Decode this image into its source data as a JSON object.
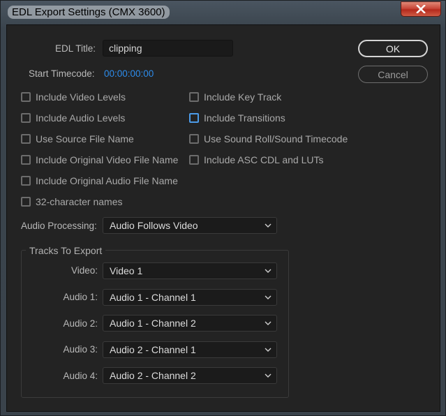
{
  "window": {
    "title": "EDL Export Settings (CMX 3600)",
    "close_icon": "close-icon"
  },
  "form": {
    "edl_title_label": "EDL Title:",
    "edl_title_value": "clipping",
    "start_timecode_label": "Start Timecode:",
    "start_timecode_value": "00:00:00:00"
  },
  "buttons": {
    "ok": "OK",
    "cancel": "Cancel"
  },
  "checkboxes": [
    {
      "label": "Include Video Levels",
      "checked": false
    },
    {
      "label": "Include Audio Levels",
      "checked": false
    },
    {
      "label": "Use Source File Name",
      "checked": false
    },
    {
      "label": "Include Original Video File Name",
      "checked": false
    },
    {
      "label": "Include Original Audio File Name",
      "checked": false
    },
    {
      "label": "32-character names",
      "checked": false
    },
    {
      "label": "Include Key Track",
      "checked": false
    },
    {
      "label": "Include Transitions",
      "checked": false,
      "focused": true
    },
    {
      "label": "Use Sound Roll/Sound Timecode",
      "checked": false
    },
    {
      "label": "Include ASC CDL and LUTs",
      "checked": false
    }
  ],
  "audio_processing": {
    "label": "Audio Processing:",
    "value": "Audio Follows Video"
  },
  "tracks": {
    "title": "Tracks To Export",
    "rows": [
      {
        "label": "Video:",
        "value": "Video 1"
      },
      {
        "label": "Audio 1:",
        "value": "Audio 1 - Channel 1"
      },
      {
        "label": "Audio 2:",
        "value": "Audio 1 - Channel 2"
      },
      {
        "label": "Audio 3:",
        "value": "Audio 2 - Channel 1"
      },
      {
        "label": "Audio 4:",
        "value": "Audio 2 - Channel 2"
      }
    ]
  },
  "colors": {
    "accent": "#2d8ceb",
    "focus": "#4c9be8",
    "background": "#232323"
  }
}
